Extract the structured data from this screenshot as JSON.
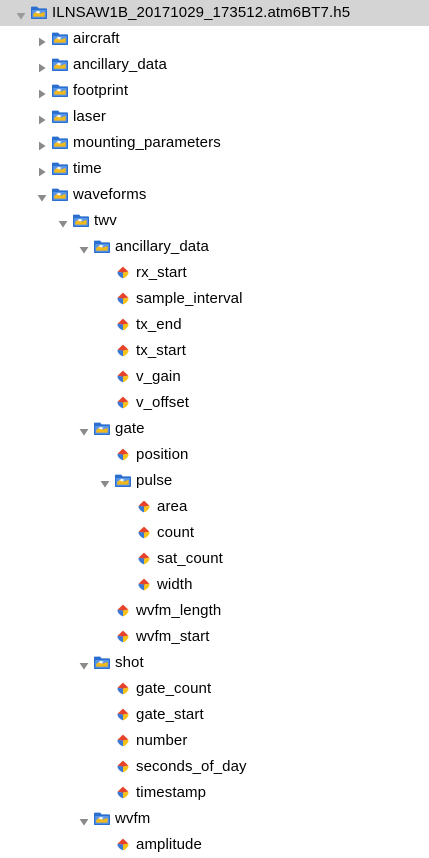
{
  "tree": {
    "rows": [
      {
        "label": "ILNSAW1B_20171029_173512.atm6BT7.h5",
        "kind": "file",
        "depth": 0,
        "expanded": true,
        "selected": true,
        "icon": "hdf-file-icon"
      },
      {
        "label": "aircraft",
        "kind": "group",
        "depth": 1,
        "expanded": false,
        "icon": "folder-icon"
      },
      {
        "label": "ancillary_data",
        "kind": "group",
        "depth": 1,
        "expanded": false,
        "icon": "folder-icon"
      },
      {
        "label": "footprint",
        "kind": "group",
        "depth": 1,
        "expanded": false,
        "icon": "folder-icon"
      },
      {
        "label": "laser",
        "kind": "group",
        "depth": 1,
        "expanded": false,
        "icon": "folder-icon"
      },
      {
        "label": "mounting_parameters",
        "kind": "group",
        "depth": 1,
        "expanded": false,
        "icon": "folder-icon"
      },
      {
        "label": "time",
        "kind": "group",
        "depth": 1,
        "expanded": false,
        "icon": "folder-icon"
      },
      {
        "label": "waveforms",
        "kind": "group",
        "depth": 1,
        "expanded": true,
        "icon": "folder-icon"
      },
      {
        "label": "twv",
        "kind": "group",
        "depth": 2,
        "expanded": true,
        "icon": "folder-icon"
      },
      {
        "label": "ancillary_data",
        "kind": "group",
        "depth": 3,
        "expanded": true,
        "icon": "folder-icon"
      },
      {
        "label": "rx_start",
        "kind": "dataset",
        "depth": 4,
        "icon": "dataset-icon"
      },
      {
        "label": "sample_interval",
        "kind": "dataset",
        "depth": 4,
        "icon": "dataset-icon"
      },
      {
        "label": "tx_end",
        "kind": "dataset",
        "depth": 4,
        "icon": "dataset-icon"
      },
      {
        "label": "tx_start",
        "kind": "dataset",
        "depth": 4,
        "icon": "dataset-icon"
      },
      {
        "label": "v_gain",
        "kind": "dataset",
        "depth": 4,
        "icon": "dataset-icon"
      },
      {
        "label": "v_offset",
        "kind": "dataset",
        "depth": 4,
        "icon": "dataset-icon"
      },
      {
        "label": "gate",
        "kind": "group",
        "depth": 3,
        "expanded": true,
        "icon": "folder-icon"
      },
      {
        "label": "position",
        "kind": "dataset",
        "depth": 4,
        "icon": "dataset-icon"
      },
      {
        "label": "pulse",
        "kind": "group",
        "depth": 4,
        "expanded": true,
        "icon": "folder-icon"
      },
      {
        "label": "area",
        "kind": "dataset",
        "depth": 5,
        "icon": "dataset-icon"
      },
      {
        "label": "count",
        "kind": "dataset",
        "depth": 5,
        "icon": "dataset-icon"
      },
      {
        "label": "sat_count",
        "kind": "dataset",
        "depth": 5,
        "icon": "dataset-icon"
      },
      {
        "label": "width",
        "kind": "dataset",
        "depth": 5,
        "icon": "dataset-icon"
      },
      {
        "label": "wvfm_length",
        "kind": "dataset",
        "depth": 4,
        "icon": "dataset-icon"
      },
      {
        "label": "wvfm_start",
        "kind": "dataset",
        "depth": 4,
        "icon": "dataset-icon"
      },
      {
        "label": "shot",
        "kind": "group",
        "depth": 3,
        "expanded": true,
        "icon": "folder-icon"
      },
      {
        "label": "gate_count",
        "kind": "dataset",
        "depth": 4,
        "icon": "dataset-icon"
      },
      {
        "label": "gate_start",
        "kind": "dataset",
        "depth": 4,
        "icon": "dataset-icon"
      },
      {
        "label": "number",
        "kind": "dataset",
        "depth": 4,
        "icon": "dataset-icon"
      },
      {
        "label": "seconds_of_day",
        "kind": "dataset",
        "depth": 4,
        "icon": "dataset-icon"
      },
      {
        "label": "timestamp",
        "kind": "dataset",
        "depth": 4,
        "icon": "dataset-icon"
      },
      {
        "label": "wvfm",
        "kind": "group",
        "depth": 3,
        "expanded": true,
        "icon": "folder-icon"
      },
      {
        "label": "amplitude",
        "kind": "dataset",
        "depth": 4,
        "icon": "dataset-icon"
      }
    ]
  },
  "colors": {
    "selection": "#d4d4d4",
    "arrow": "#8a8a8a",
    "arrow_selected": "#9a9a9a",
    "folder_blue": "#2a6fd0",
    "folder_yellow": "#f2b91a",
    "dataset_red": "#e6432b",
    "dataset_blue": "#3a78d4",
    "dataset_yellow": "#f4c21b"
  }
}
